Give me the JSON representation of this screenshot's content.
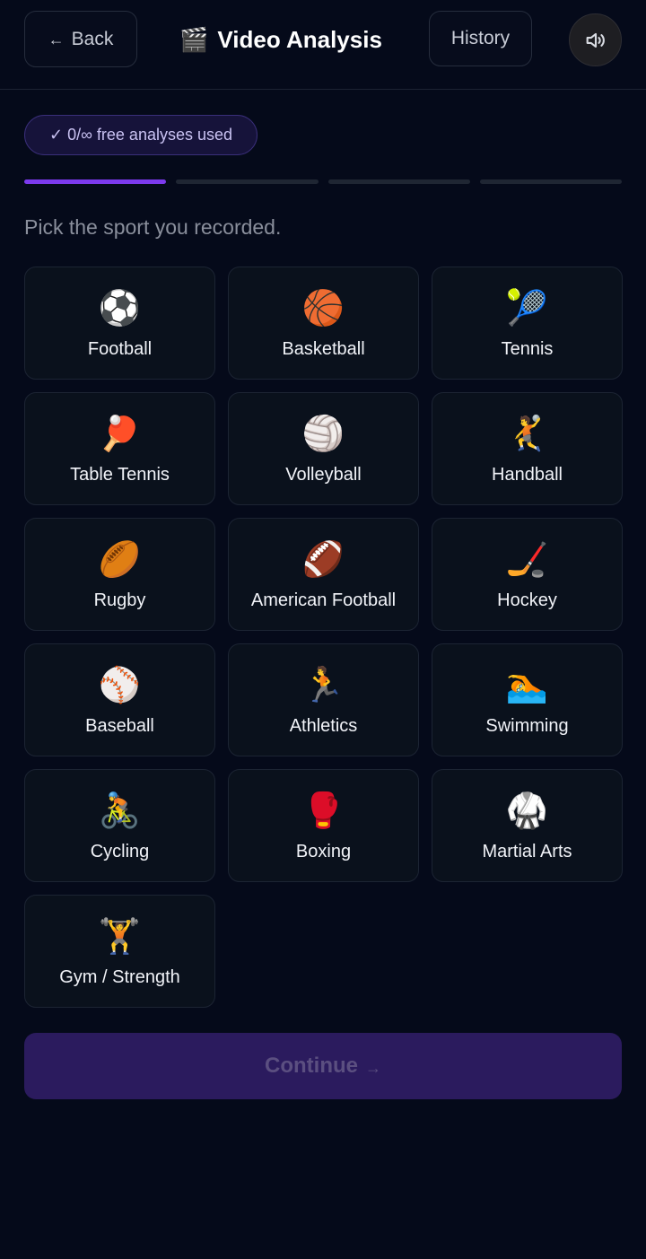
{
  "header": {
    "back_arrow": "←",
    "back_label": "Back",
    "title_icon": "🎬",
    "title": "Video Analysis",
    "history_label": "History",
    "sound_icon": "speaker-icon"
  },
  "badge": {
    "text": "✓ 0/∞ free analyses used"
  },
  "progress": {
    "total_steps": 4,
    "current_step": 1
  },
  "prompt": "Pick the sport you recorded.",
  "sports": [
    {
      "emoji": "⚽",
      "label": "Football"
    },
    {
      "emoji": "🏀",
      "label": "Basketball"
    },
    {
      "emoji": "🎾",
      "label": "Tennis"
    },
    {
      "emoji": "🏓",
      "label": "Table Tennis"
    },
    {
      "emoji": "🏐",
      "label": "Volleyball"
    },
    {
      "emoji": "🤾",
      "label": "Handball"
    },
    {
      "emoji": "🏉",
      "label": "Rugby"
    },
    {
      "emoji": "🏈",
      "label": "American Football"
    },
    {
      "emoji": "🏒",
      "label": "Hockey"
    },
    {
      "emoji": "⚾",
      "label": "Baseball"
    },
    {
      "emoji": "🏃",
      "label": "Athletics"
    },
    {
      "emoji": "🏊",
      "label": "Swimming"
    },
    {
      "emoji": "🚴",
      "label": "Cycling"
    },
    {
      "emoji": "🥊",
      "label": "Boxing"
    },
    {
      "emoji": "🥋",
      "label": "Martial Arts"
    },
    {
      "emoji": "🏋️",
      "label": "Gym / Strength"
    }
  ],
  "continue": {
    "label": "Continue",
    "arrow": "→"
  },
  "colors": {
    "background": "#050a1a",
    "accent": "#7c3aed",
    "continue_bg": "#2b1b5e"
  }
}
